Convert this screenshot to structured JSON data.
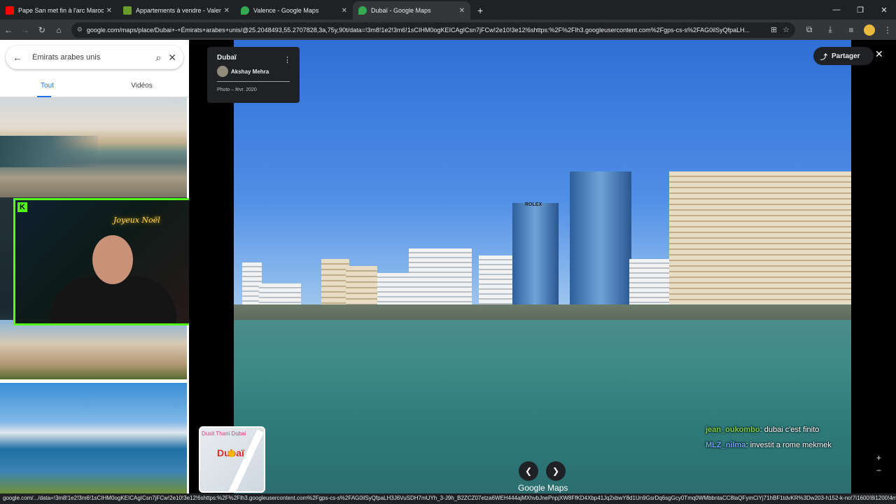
{
  "browser": {
    "tabs": [
      {
        "title": "Pape San met fin à l'arc Maroc...",
        "color": "#ff0000"
      },
      {
        "title": "Appartements à vendre - Valen...",
        "color": "#6a9b2f"
      },
      {
        "title": "Valence - Google Maps",
        "color": "#34a853"
      },
      {
        "title": "Dubaï - Google Maps",
        "color": "#34a853"
      }
    ],
    "new_tab": "+",
    "url": "google.com/maps/place/Dubai+-+Émirats+arabes+unis/@25.2048493,55.2707828,3a,75y,90t/data=!3m8!1e2!3m6!1sCIHM0ogKEICAgICsn7jFCw!2e10!3e12!6shttps:%2F%2Flh3.googleusercontent.com%2Fgps-cs-s%2FAG0ilSyQfpaLH..."
  },
  "sidebar": {
    "search_value": "Émirats arabes unis",
    "tabs": [
      "Tout",
      "Vidéos"
    ]
  },
  "photo": {
    "place": "Dubaï",
    "author": "Akshay Mehra",
    "date": "Photo – févr. 2020",
    "share_label": "Partager",
    "brand": "Google Maps"
  },
  "minimap": {
    "hotel": "Dusit Thani Dubai",
    "city": "Dubaï"
  },
  "chat": [
    {
      "user": "jean_oukombo",
      "msg": ": dubai c'est finito"
    },
    {
      "user": "MLZ_nilma",
      "msg": ": investit a rome mekmek"
    }
  ],
  "stream": {
    "overlay_text": "Joyeux Noël"
  },
  "statusbar": {
    "text": "google.com/.../data=!3m8!1e2!3m6!1sCIHM0ogKEICAgICsn7jFCw!2e10!3e12!6shttps:%2F%2Flh3.googleusercontent.com%2Fgps-cs-s%2FAG0ilSyQfpaLH3J6VuSDH7mUYh_3-J9h_B2ZCZ07etza6WEH444ajMXhvbJnePnpjXW8FfKD4Xbp41Jq2xbwY8d1Un9GsrDq6sgGcy0Tmq0WMbbntaCC8laQFymCiYj71hBF1tdvKR%3Dw203-h152-k-no!7i1600!8i1200!4m16!..."
  }
}
